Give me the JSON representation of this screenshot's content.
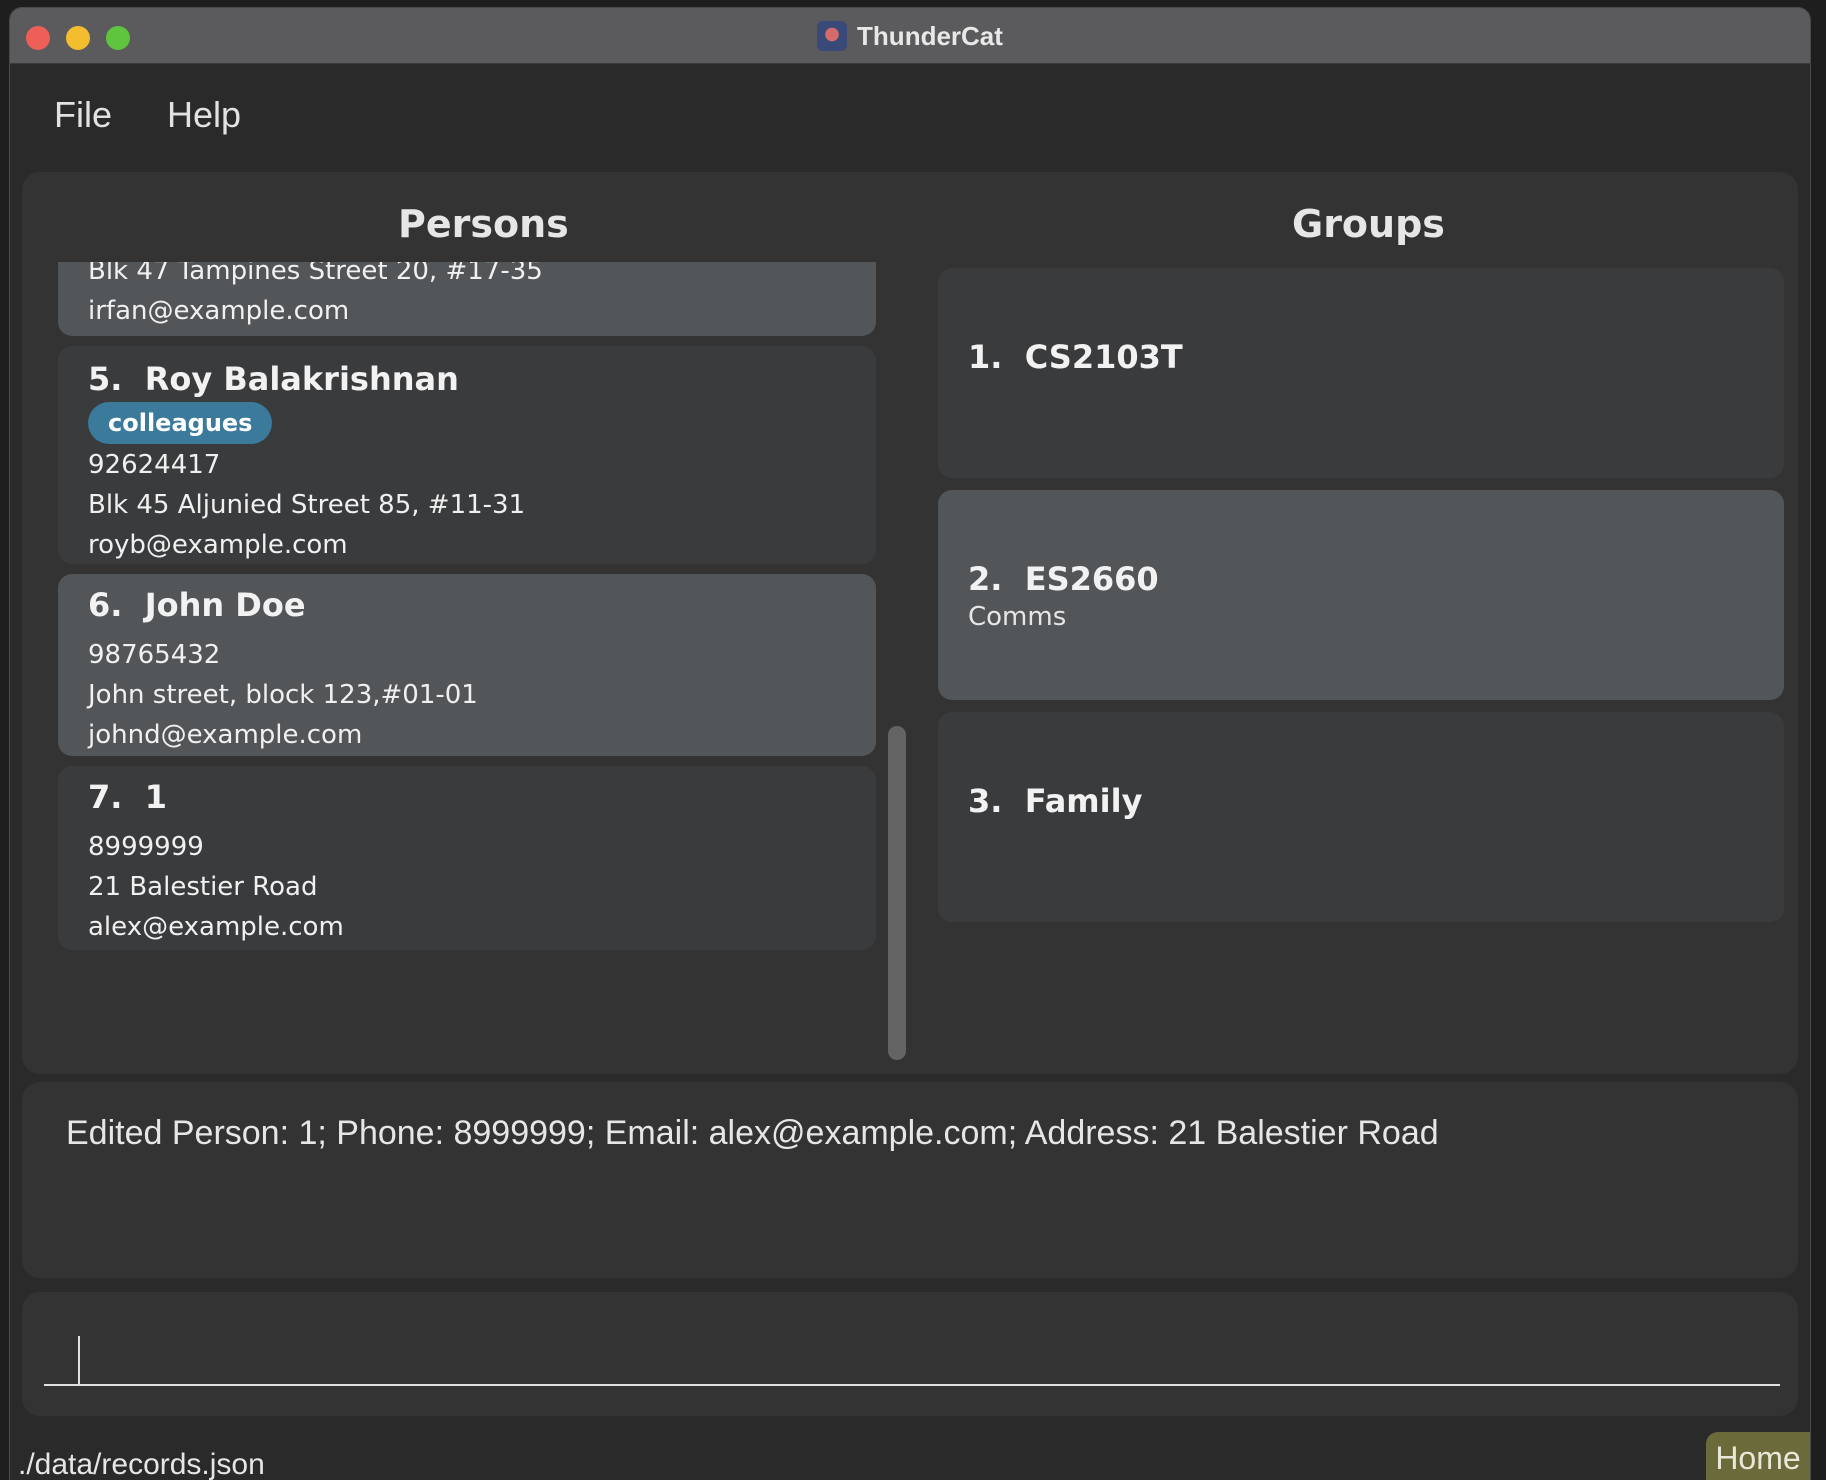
{
  "window": {
    "title": "ThunderCat",
    "app_icon": "thundercat-logo-icon"
  },
  "menu": {
    "items": [
      {
        "label": "File"
      },
      {
        "label": "Help"
      }
    ]
  },
  "persons_panel": {
    "title": "Persons",
    "cards": [
      {
        "partial": true,
        "address": "Blk 47 Tampines Street 20, #17-35",
        "email": "irfan@example.com"
      },
      {
        "index": "5.",
        "name": "Roy Balakrishnan",
        "tag": "colleagues",
        "phone": "92624417",
        "address": "Blk 45 Aljunied Street 85, #11-31",
        "email": "royb@example.com"
      },
      {
        "index": "6.",
        "name": "John Doe",
        "phone": "98765432",
        "address": "John street, block 123,#01-01",
        "email": "johnd@example.com"
      },
      {
        "index": "7.",
        "name": "1",
        "phone": "8999999",
        "address": "21 Balestier Road",
        "email": "alex@example.com"
      }
    ]
  },
  "groups_panel": {
    "title": "Groups",
    "cards": [
      {
        "index": "1.",
        "name": "CS2103T",
        "description": ""
      },
      {
        "index": "2.",
        "name": "ES2660",
        "description": "Comms"
      },
      {
        "index": "3.",
        "name": "Family",
        "description": ""
      }
    ]
  },
  "result_display": {
    "text": "Edited Person: 1; Phone: 8999999; Email: alex@example.com; Address: 21 Balestier Road"
  },
  "command_box": {
    "value": "",
    "placeholder": ""
  },
  "status_bar": {
    "path": "./data/records.json",
    "view_label": "Home"
  },
  "colors": {
    "tag_background": "#3b7a9a",
    "selected_card": "#525659",
    "card": "#3a3b3d",
    "home_badge": "#6b6a3a"
  }
}
